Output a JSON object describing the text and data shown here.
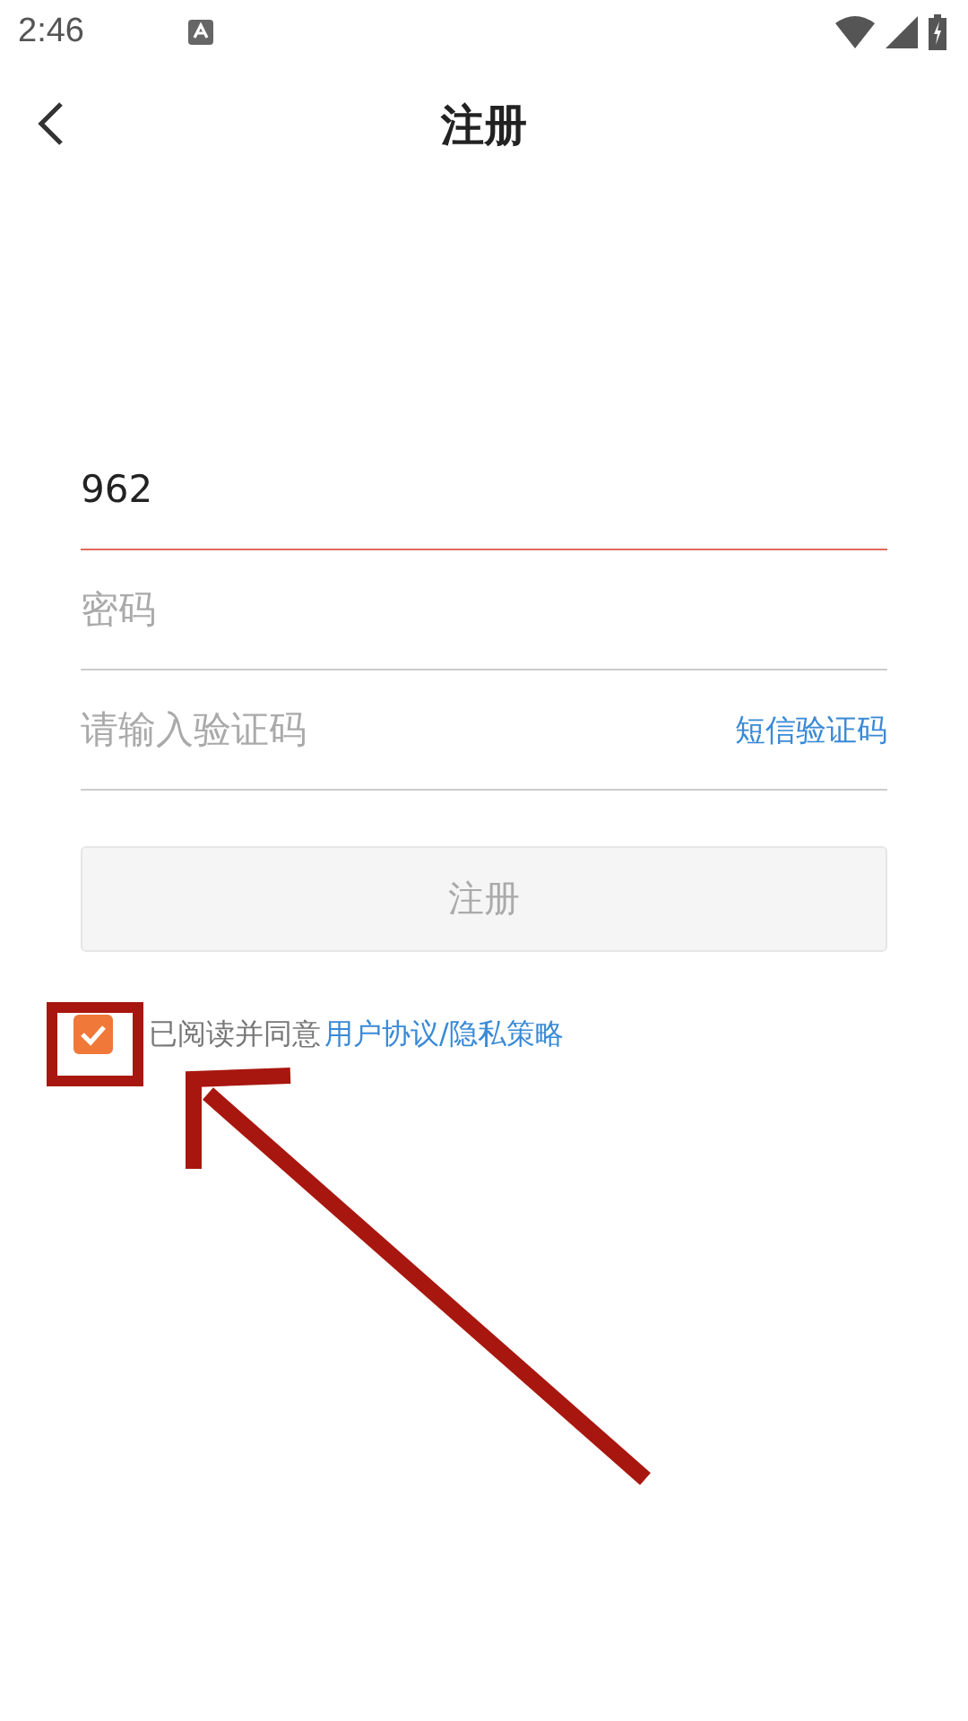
{
  "status_bar": {
    "time": "2:46"
  },
  "header": {
    "title": "注册"
  },
  "fields": [
    {
      "kind": "text",
      "value": "962",
      "focused": true
    },
    {
      "kind": "password",
      "placeholder": "密码",
      "focused": false
    },
    {
      "kind": "code",
      "placeholder": "请输入验证码",
      "action": "短信验证码",
      "focused": false
    }
  ],
  "submit": {
    "label": "注册",
    "disabled": true
  },
  "agreement": {
    "checked": true,
    "text": "已阅读并同意",
    "link": "用户协议/隐私策略"
  },
  "annotation": {
    "kind": "arrow"
  }
}
